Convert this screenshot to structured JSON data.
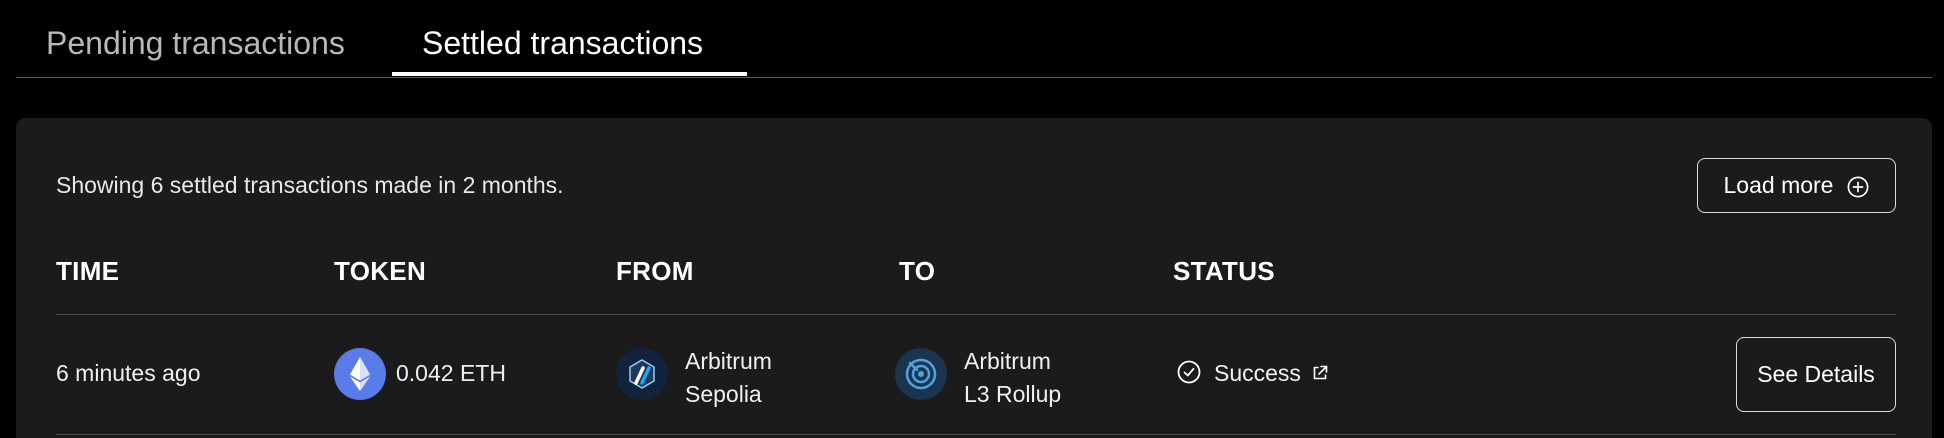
{
  "tabs": {
    "pending_label": "Pending transactions",
    "settled_label": "Settled transactions",
    "active": "Settled transactions"
  },
  "panel": {
    "summary": "Showing 6 settled transactions made in 2 months.",
    "load_more_label": "Load more",
    "columns": {
      "time": "TIME",
      "token": "TOKEN",
      "from": "FROM",
      "to": "TO",
      "status": "STATUS"
    },
    "rows": [
      {
        "time": "6 minutes ago",
        "token_amount": "0.042 ETH",
        "token_icon": "ethereum-icon",
        "from_line1": "Arbitrum",
        "from_line2": "Sepolia",
        "from_icon": "arbitrum-icon",
        "to_line1": "Arbitrum",
        "to_line2": "L3 Rollup",
        "to_icon": "l3-rollup-icon",
        "status": "Success",
        "status_icon": "check-circle-icon",
        "details_label": "See Details"
      }
    ]
  },
  "colors": {
    "background": "#000000",
    "panel": "#1b1b1b",
    "ethereum": "#5a7ce8",
    "arbitrum": "#12243d",
    "rollup": "#1a3550"
  }
}
